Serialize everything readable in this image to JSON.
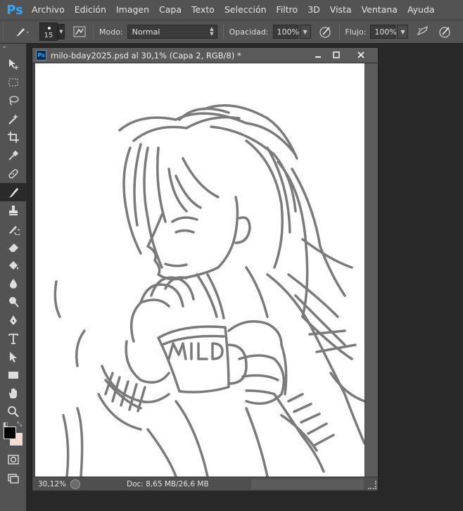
{
  "app": {
    "logo": "Ps"
  },
  "menu": [
    "Archivo",
    "Edición",
    "Imagen",
    "Capa",
    "Texto",
    "Selección",
    "Filtro",
    "3D",
    "Vista",
    "Ventana",
    "Ayuda"
  ],
  "options": {
    "brush_size": "15",
    "mode_label": "Modo:",
    "mode_value": "Normal",
    "opacity_label": "Opacidad:",
    "opacity_value": "100%",
    "flow_label": "Flujo:",
    "flow_value": "100%"
  },
  "document": {
    "title": "milo-bday2025.psd al 30,1% (Capa 2, RGB/8) *",
    "zoom": "30,12%",
    "doc_info": "Doc: 8,65 MB/26,6 MB",
    "mug_text": "MILO"
  },
  "colors": {
    "foreground": "#000000",
    "background": "#f6ddd1",
    "ui_panel": "#535353",
    "sketch_stroke": "#7a7a7a"
  },
  "tools": [
    "move-icon",
    "marquee-icon",
    "lasso-icon",
    "magic-wand-icon",
    "crop-icon",
    "eyedropper-icon",
    "healing-icon",
    "brush-icon",
    "stamp-icon",
    "history-brush-icon",
    "eraser-icon",
    "paint-bucket-icon",
    "blur-icon",
    "dodge-icon",
    "pen-icon",
    "type-icon",
    "path-select-icon",
    "rectangle-icon",
    "hand-icon",
    "zoom-icon"
  ]
}
